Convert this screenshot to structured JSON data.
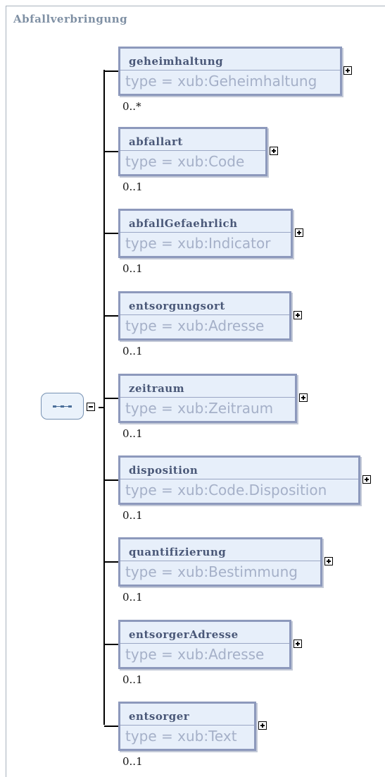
{
  "title": "Abfallverbringung",
  "sequence": {
    "icon": "sequence-compositor-icon",
    "toggle": "collapse"
  },
  "elements": [
    {
      "name": "geheimhaltung",
      "type": "type = xub:Geheimhaltung",
      "cardinality": "0..*",
      "toggle": "expand"
    },
    {
      "name": "abfallart",
      "type": "type = xub:Code",
      "cardinality": "0..1",
      "toggle": "expand"
    },
    {
      "name": "abfallGefaehrlich",
      "type": "type = xub:Indicator",
      "cardinality": "0..1",
      "toggle": "expand"
    },
    {
      "name": "entsorgungsort",
      "type": "type = xub:Adresse",
      "cardinality": "0..1",
      "toggle": "expand"
    },
    {
      "name": "zeitraum",
      "type": "type = xub:Zeitraum",
      "cardinality": "0..1",
      "toggle": "expand"
    },
    {
      "name": "disposition",
      "type": "type = xub:Code.Disposition",
      "cardinality": "0..1",
      "toggle": "expand"
    },
    {
      "name": "quantifizierung",
      "type": "type = xub:Bestimmung",
      "cardinality": "0..1",
      "toggle": "expand"
    },
    {
      "name": "entsorgerAdresse",
      "type": "type = xub:Adresse",
      "cardinality": "0..1",
      "toggle": "expand"
    },
    {
      "name": "entsorger",
      "type": "type = xub:Text",
      "cardinality": "0..1",
      "toggle": "expand"
    }
  ]
}
